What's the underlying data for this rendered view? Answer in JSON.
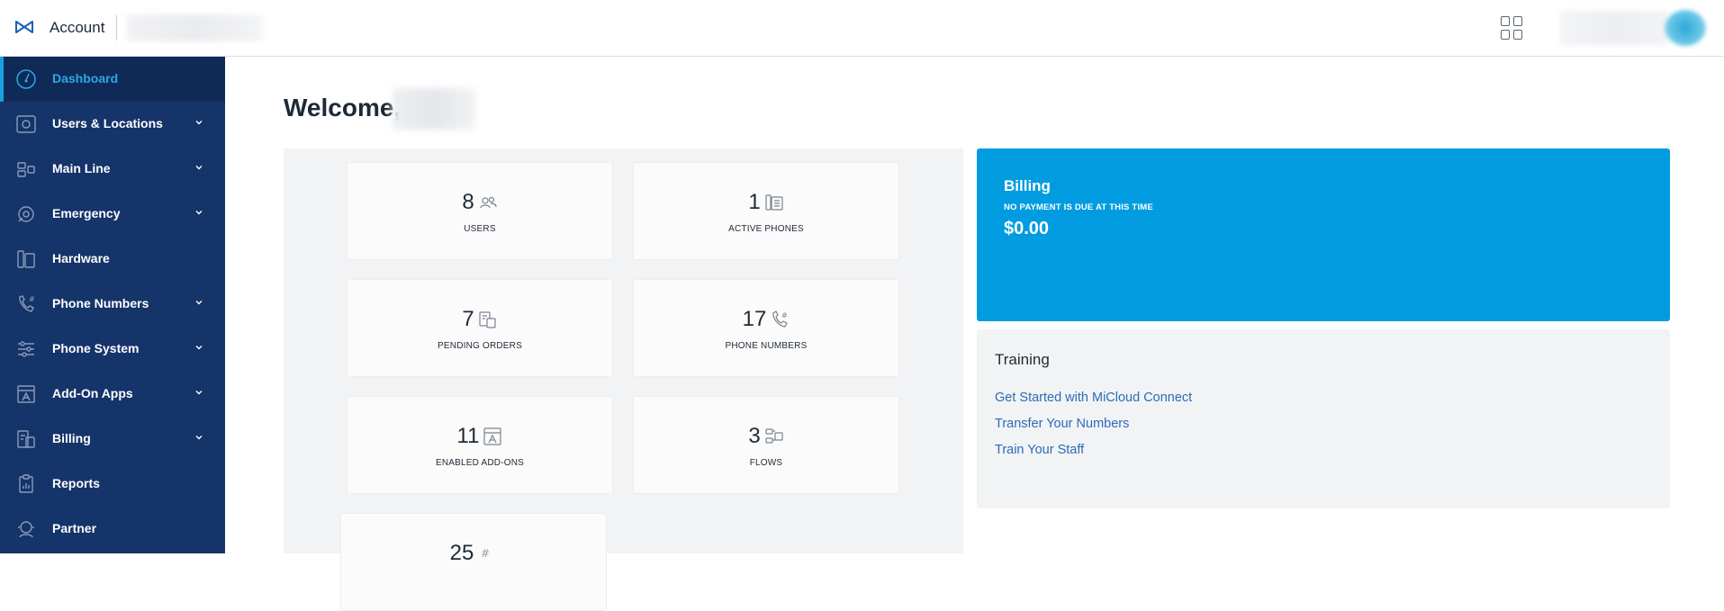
{
  "header": {
    "app_title": "Account",
    "logo_icon": "micloud-logo-icon",
    "apps_icon": "apps-grid-icon"
  },
  "sidebar": {
    "items": [
      {
        "label": "Dashboard",
        "icon": "speedometer-icon",
        "expandable": false,
        "active": true
      },
      {
        "label": "Users & Locations",
        "icon": "location-pin-icon",
        "expandable": true
      },
      {
        "label": "Main Line",
        "icon": "main-line-icon",
        "expandable": true
      },
      {
        "label": "Emergency",
        "icon": "emergency-icon",
        "expandable": true
      },
      {
        "label": "Hardware",
        "icon": "hardware-icon",
        "expandable": false
      },
      {
        "label": "Phone Numbers",
        "icon": "phone-hash-icon",
        "expandable": true
      },
      {
        "label": "Phone System",
        "icon": "sliders-icon",
        "expandable": true
      },
      {
        "label": "Add-On Apps",
        "icon": "apps-store-icon",
        "expandable": true
      },
      {
        "label": "Billing",
        "icon": "billing-icon",
        "expandable": true
      },
      {
        "label": "Reports",
        "icon": "reports-icon",
        "expandable": false
      },
      {
        "label": "Partner",
        "icon": "partner-icon",
        "expandable": false
      }
    ]
  },
  "main": {
    "welcome": "Welcome,",
    "stats": [
      {
        "value": "8",
        "label": "USERS",
        "icon": "users-icon"
      },
      {
        "value": "1",
        "label": "ACTIVE PHONES",
        "icon": "desk-phone-icon"
      },
      {
        "value": "7",
        "label": "PENDING ORDERS",
        "icon": "pending-orders-icon"
      },
      {
        "value": "17",
        "label": "PHONE NUMBERS",
        "icon": "phone-hash-icon"
      },
      {
        "value": "11",
        "label": "ENABLED ADD-ONS",
        "icon": "apps-store-icon"
      },
      {
        "value": "3",
        "label": "FLOWS",
        "icon": "flows-icon"
      },
      {
        "value": "25",
        "label": "",
        "icon": "hash-icon"
      }
    ],
    "billing": {
      "title": "Billing",
      "subtitle": "NO PAYMENT IS DUE AT THIS TIME",
      "amount": "$0.00"
    },
    "training": {
      "title": "Training",
      "links": [
        "Get Started with MiCloud Connect",
        "Transfer Your Numbers",
        "Train Your Staff"
      ]
    }
  },
  "colors": {
    "sidebar": "#15346a",
    "accent": "#019ce0",
    "link": "#2b6cb8"
  }
}
